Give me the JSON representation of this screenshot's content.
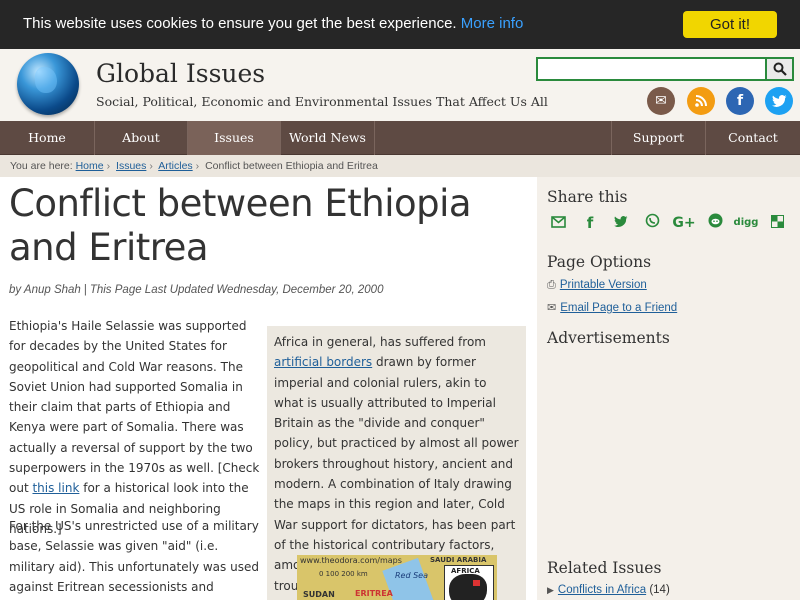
{
  "cookie": {
    "message": "This website uses cookies to ensure you get the best experience.",
    "more_info": "More info",
    "button": "Got it!"
  },
  "header": {
    "title": "Global Issues",
    "tagline": "Social, Political, Economic and Environmental Issues That Affect Us All",
    "search_value": "",
    "social": [
      {
        "name": "email-icon",
        "glyph": "✉",
        "color": "#7a5a4a"
      },
      {
        "name": "rss-icon",
        "glyph": "◉",
        "color": "#f39c12"
      },
      {
        "name": "facebook-icon",
        "glyph": "f",
        "color": "#2d66b3"
      },
      {
        "name": "twitter-icon",
        "glyph": "t",
        "color": "#1da1f2"
      }
    ]
  },
  "nav": {
    "home": "Home",
    "about": "About",
    "issues": "Issues",
    "world_news": "World News",
    "support": "Support",
    "contact": "Contact"
  },
  "breadcrumb": {
    "prefix": "You are here:",
    "home": "Home",
    "issues": "Issues",
    "articles": "Articles",
    "current": "Conflict between Ethiopia and Eritrea"
  },
  "article": {
    "title": "Conflict between Ethiopia and Eritrea",
    "author": "by Anup Shah",
    "updated": "This Page Last Updated Wednesday, December 20, 2000",
    "p1_before": "Ethiopia's Haile Selassie was supported for decades by the United States for geopolitical and Cold War reasons. The Soviet Union had supported Somalia in their claim that parts of Ethiopia and Kenya were part of Somalia. There was actually a reversal of support by the two superpowers in the 1970s as well. [Check out ",
    "p1_link": "this link",
    "p1_after": " for a historical look into the US role in Somalia and neighboring nations.]",
    "p2": "For the US's unrestricted use of a military base, Selassie was given \"aid\" (i.e. military aid). This unfortunately was used against Eritrean secessionists and Ethopian guerillas in brutal",
    "aside_before": "Africa in general, has suffered from ",
    "aside_link": "artificial borders",
    "aside_after": " drawn by former imperial and colonial rulers, akin to what is usually attributed to Imperial Britain as the \"divide and conquer\" policy, but practiced by almost all power brokers throughout history, ancient and modern. A combination of Italy drawing the maps in this region and later, Cold War support for dictators, has been part of the historical contributary factors, amongst others, that have led to troubles today.",
    "map": {
      "url": "www.theodora.com/maps",
      "scale": "0  100 200 km",
      "sudan": "SUDAN",
      "eritrea": "ERITREA",
      "red_sea": "Red Sea",
      "saudi": "SAUDI ARABIA",
      "inset": "AFRICA"
    }
  },
  "sidebar": {
    "share_title": "Share this",
    "share_icons": [
      {
        "name": "email-share-icon",
        "glyph": "✉"
      },
      {
        "name": "facebook-share-icon",
        "glyph": "f"
      },
      {
        "name": "twitter-share-icon",
        "glyph": "t"
      },
      {
        "name": "whatsapp-share-icon",
        "glyph": "☏"
      },
      {
        "name": "google-plus-share-icon",
        "glyph": "G+"
      },
      {
        "name": "reddit-share-icon",
        "glyph": "●"
      },
      {
        "name": "digg-share-icon",
        "glyph": "digg"
      },
      {
        "name": "delicious-share-icon",
        "glyph": "◩"
      }
    ],
    "options_title": "Page Options",
    "printable": "Printable Version",
    "email_friend": "Email Page to a Friend",
    "ads_title": "Advertisements",
    "related_title": "Related Issues",
    "related_link": "Conflicts in Africa",
    "related_count": "(14)"
  }
}
